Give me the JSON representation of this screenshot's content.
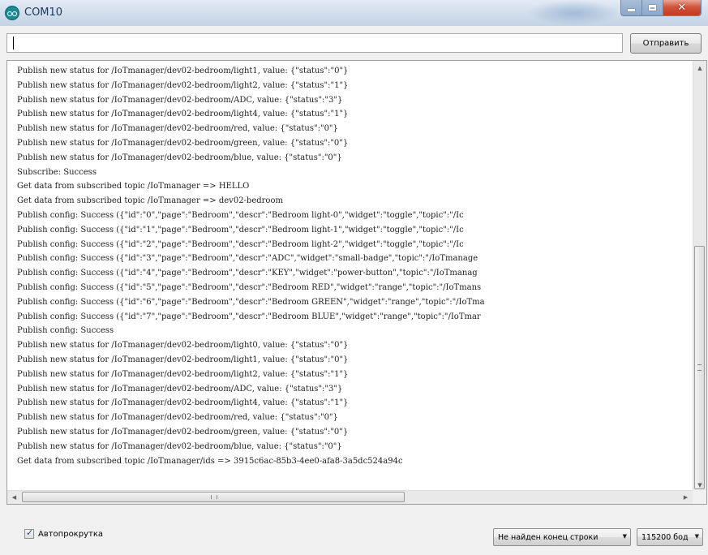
{
  "window": {
    "title": "COM10"
  },
  "send_row": {
    "input_value": "",
    "send_label": "Отправить"
  },
  "output": {
    "lines": [
      "Publish new status for /IoTmanager/dev02-bedroom/light1, value: {\"status\":\"0\"}",
      "Publish new status for /IoTmanager/dev02-bedroom/light2, value: {\"status\":\"1\"}",
      "Publish new status for /IoTmanager/dev02-bedroom/ADC, value: {\"status\":\"3\"}",
      "Publish new status for /IoTmanager/dev02-bedroom/light4, value: {\"status\":\"1\"}",
      "Publish new status for /IoTmanager/dev02-bedroom/red, value: {\"status\":\"0\"}",
      "Publish new status for /IoTmanager/dev02-bedroom/green, value: {\"status\":\"0\"}",
      "Publish new status for /IoTmanager/dev02-bedroom/blue, value: {\"status\":\"0\"}",
      "Subscribe: Success",
      "Get data from subscribed topic /IoTmanager => HELLO",
      "Get data from subscribed topic /IoTmanager => dev02-bedroom",
      "Publish config: Success ({\"id\":\"0\",\"page\":\"Bedroom\",\"descr\":\"Bedroom light-0\",\"widget\":\"toggle\",\"topic\":\"/Ic",
      "Publish config: Success ({\"id\":\"1\",\"page\":\"Bedroom\",\"descr\":\"Bedroom light-1\",\"widget\":\"toggle\",\"topic\":\"/Ic",
      "Publish config: Success ({\"id\":\"2\",\"page\":\"Bedroom\",\"descr\":\"Bedroom light-2\",\"widget\":\"toggle\",\"topic\":\"/Ic",
      "Publish config: Success ({\"id\":\"3\",\"page\":\"Bedroom\",\"descr\":\"ADC\",\"widget\":\"small-badge\",\"topic\":\"/IoTmanage",
      "Publish config: Success ({\"id\":\"4\",\"page\":\"Bedroom\",\"descr\":\"KEY\",\"widget\":\"power-button\",\"topic\":\"/IoTmanag",
      "Publish config: Success ({\"id\":\"5\",\"page\":\"Bedroom\",\"descr\":\"Bedroom RED\",\"widget\":\"range\",\"topic\":\"/IoTmans",
      "Publish config: Success ({\"id\":\"6\",\"page\":\"Bedroom\",\"descr\":\"Bedroom GREEN\",\"widget\":\"range\",\"topic\":\"/IoTma",
      "Publish config: Success ({\"id\":\"7\",\"page\":\"Bedroom\",\"descr\":\"Bedroom BLUE\",\"widget\":\"range\",\"topic\":\"/IoTmar",
      "Publish config: Success",
      "Publish new status for /IoTmanager/dev02-bedroom/light0, value: {\"status\":\"0\"}",
      "Publish new status for /IoTmanager/dev02-bedroom/light1, value: {\"status\":\"0\"}",
      "Publish new status for /IoTmanager/dev02-bedroom/light2, value: {\"status\":\"1\"}",
      "Publish new status for /IoTmanager/dev02-bedroom/ADC, value: {\"status\":\"3\"}",
      "Publish new status for /IoTmanager/dev02-bedroom/light4, value: {\"status\":\"1\"}",
      "Publish new status for /IoTmanager/dev02-bedroom/red, value: {\"status\":\"0\"}",
      "Publish new status for /IoTmanager/dev02-bedroom/green, value: {\"status\":\"0\"}",
      "Publish new status for /IoTmanager/dev02-bedroom/blue, value: {\"status\":\"0\"}",
      "Get data from subscribed topic /IoTmanager/ids => 3915c6ac-85b3-4ee0-afa8-3a5dc524a94c"
    ]
  },
  "bottom": {
    "autoscroll_label": "Автопрокрутка",
    "autoscroll_checked": true,
    "line_ending_value": "Не найден конец строки",
    "baud_value": "115200 бод"
  },
  "icons": {
    "app": "arduino-icon",
    "minimize": "minimize-icon",
    "maximize": "maximize-icon",
    "close": "close-icon"
  },
  "colors": {
    "titlebar": "#d2deec",
    "close_button": "#c43a21",
    "arduino_teal": "#1c8a97"
  }
}
